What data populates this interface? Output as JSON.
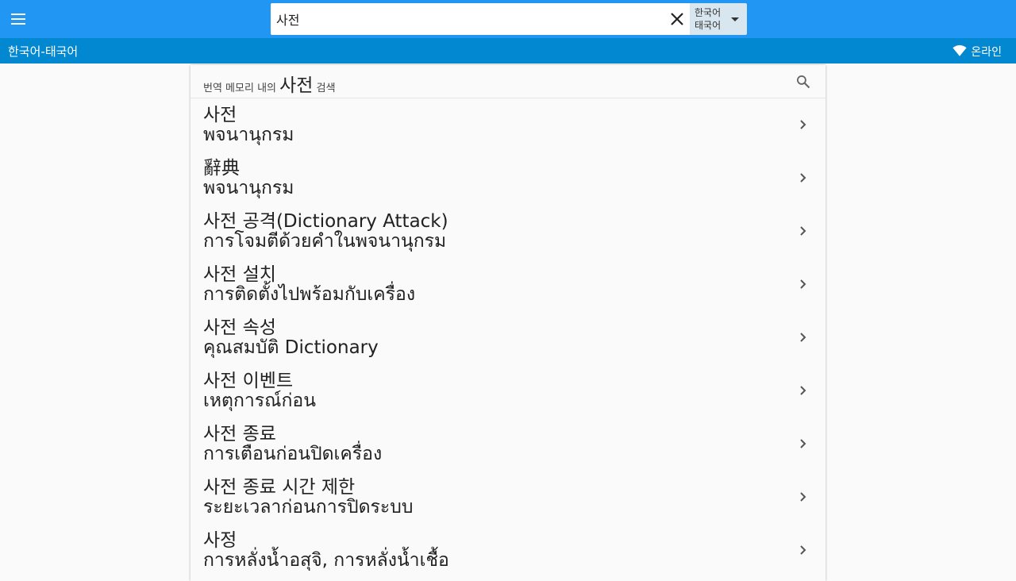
{
  "topbar": {
    "search_value": "사전",
    "lang_from": "한국어",
    "lang_to": "태국어"
  },
  "subbar": {
    "pair_label": "한국어-태국어",
    "status_label": "온라인"
  },
  "results_header": {
    "prefix": "번역 메모리 내의",
    "query": "사전",
    "suffix": "검색"
  },
  "entries": [
    {
      "source": "사전",
      "target": "พจนานุกรม"
    },
    {
      "source": "辭典",
      "target": "พจนานุกรม"
    },
    {
      "source": "사전 공격(Dictionary Attack)",
      "target": "การโจมตีด้วยคำในพจนานุกรม"
    },
    {
      "source": "사전 설치",
      "target": "การติดตั้งไปพร้อมกับเครื่อง"
    },
    {
      "source": "사전 속성",
      "target": "คุณสมบัติ Dictionary"
    },
    {
      "source": "사전 이벤트",
      "target": "เหตุการณ์ก่อน"
    },
    {
      "source": "사전 종료",
      "target": "การเตือนก่อนปิดเครื่อง"
    },
    {
      "source": "사전 종료 시간 제한",
      "target": "ระยะเวลาก่อนการปิดระบบ"
    },
    {
      "source": "사정",
      "target": "การหลั่งน้ำอสุจิ, การหลั่งน้ำเชื้อ"
    }
  ],
  "colors": {
    "topbar": "#2196f3",
    "subbar": "#0288d1",
    "background": "#fafafa"
  }
}
